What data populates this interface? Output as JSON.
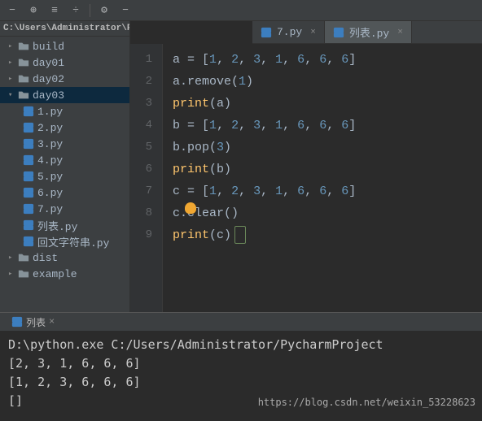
{
  "toolbar": {
    "icons": [
      "minimize",
      "target",
      "collapse",
      "divide",
      "gear",
      "hide"
    ]
  },
  "tabs": [
    {
      "label": "7.py",
      "active": false
    },
    {
      "label": "列表.py",
      "active": true
    }
  ],
  "breadcrumb": "C:\\Users\\Administrator\\P",
  "tree": [
    {
      "type": "folder",
      "label": "build",
      "lvl": 1,
      "open": false
    },
    {
      "type": "folder",
      "label": "day01",
      "lvl": 1,
      "open": false
    },
    {
      "type": "folder",
      "label": "day02",
      "lvl": 1,
      "open": false
    },
    {
      "type": "folder",
      "label": "day03",
      "lvl": 1,
      "open": true,
      "selected": true
    },
    {
      "type": "file",
      "label": "1.py",
      "lvl": 2
    },
    {
      "type": "file",
      "label": "2.py",
      "lvl": 2
    },
    {
      "type": "file",
      "label": "3.py",
      "lvl": 2
    },
    {
      "type": "file",
      "label": "4.py",
      "lvl": 2
    },
    {
      "type": "file",
      "label": "5.py",
      "lvl": 2
    },
    {
      "type": "file",
      "label": "6.py",
      "lvl": 2
    },
    {
      "type": "file",
      "label": "7.py",
      "lvl": 2
    },
    {
      "type": "file",
      "label": "列表.py",
      "lvl": 2
    },
    {
      "type": "file",
      "label": "回文字符串.py",
      "lvl": 2
    },
    {
      "type": "folder",
      "label": "dist",
      "lvl": 1,
      "open": false
    },
    {
      "type": "folder",
      "label": "example",
      "lvl": 1,
      "open": false
    }
  ],
  "code": {
    "lines": [
      {
        "n": 1,
        "tokens": [
          {
            "t": "a ",
            "c": "var"
          },
          {
            "t": "= ",
            "c": "punct"
          },
          {
            "t": "[",
            "c": "punct"
          },
          {
            "t": "1",
            "c": "num"
          },
          {
            "t": ", ",
            "c": "punct"
          },
          {
            "t": "2",
            "c": "num"
          },
          {
            "t": ", ",
            "c": "punct"
          },
          {
            "t": "3",
            "c": "num"
          },
          {
            "t": ", ",
            "c": "punct"
          },
          {
            "t": "1",
            "c": "num"
          },
          {
            "t": ", ",
            "c": "punct"
          },
          {
            "t": "6",
            "c": "num"
          },
          {
            "t": ", ",
            "c": "punct"
          },
          {
            "t": "6",
            "c": "num"
          },
          {
            "t": ", ",
            "c": "punct"
          },
          {
            "t": "6",
            "c": "num"
          },
          {
            "t": "]",
            "c": "punct"
          }
        ]
      },
      {
        "n": 2,
        "tokens": [
          {
            "t": "a.remove(",
            "c": "var"
          },
          {
            "t": "1",
            "c": "num"
          },
          {
            "t": ")",
            "c": "var"
          }
        ]
      },
      {
        "n": 3,
        "tokens": [
          {
            "t": "print",
            "c": "call"
          },
          {
            "t": "(a)",
            "c": "var"
          }
        ]
      },
      {
        "n": 4,
        "tokens": [
          {
            "t": "b ",
            "c": "var"
          },
          {
            "t": "= ",
            "c": "punct"
          },
          {
            "t": "[",
            "c": "punct"
          },
          {
            "t": "1",
            "c": "num"
          },
          {
            "t": ", ",
            "c": "punct"
          },
          {
            "t": "2",
            "c": "num"
          },
          {
            "t": ", ",
            "c": "punct"
          },
          {
            "t": "3",
            "c": "num"
          },
          {
            "t": ", ",
            "c": "punct"
          },
          {
            "t": "1",
            "c": "num"
          },
          {
            "t": ", ",
            "c": "punct"
          },
          {
            "t": "6",
            "c": "num"
          },
          {
            "t": ", ",
            "c": "punct"
          },
          {
            "t": "6",
            "c": "num"
          },
          {
            "t": ", ",
            "c": "punct"
          },
          {
            "t": "6",
            "c": "num"
          },
          {
            "t": "]",
            "c": "punct"
          }
        ]
      },
      {
        "n": 5,
        "tokens": [
          {
            "t": "b.pop(",
            "c": "var"
          },
          {
            "t": "3",
            "c": "num"
          },
          {
            "t": ")",
            "c": "var"
          }
        ]
      },
      {
        "n": 6,
        "tokens": [
          {
            "t": "print",
            "c": "call"
          },
          {
            "t": "(b)",
            "c": "var"
          }
        ]
      },
      {
        "n": 7,
        "tokens": [
          {
            "t": "c ",
            "c": "var"
          },
          {
            "t": "= ",
            "c": "punct"
          },
          {
            "t": "[",
            "c": "punct"
          },
          {
            "t": "1",
            "c": "num"
          },
          {
            "t": ", ",
            "c": "punct"
          },
          {
            "t": "2",
            "c": "num"
          },
          {
            "t": ", ",
            "c": "punct"
          },
          {
            "t": "3",
            "c": "num"
          },
          {
            "t": ", ",
            "c": "punct"
          },
          {
            "t": "1",
            "c": "num"
          },
          {
            "t": ", ",
            "c": "punct"
          },
          {
            "t": "6",
            "c": "num"
          },
          {
            "t": ", ",
            "c": "punct"
          },
          {
            "t": "6",
            "c": "num"
          },
          {
            "t": ", ",
            "c": "punct"
          },
          {
            "t": "6",
            "c": "num"
          },
          {
            "t": "]",
            "c": "punct"
          }
        ]
      },
      {
        "n": 8,
        "tokens": [
          {
            "t": "c.clear()",
            "c": "var"
          }
        ]
      },
      {
        "n": 9,
        "tokens": [
          {
            "t": "print",
            "c": "call"
          },
          {
            "t": "(",
            "c": "var"
          },
          {
            "t": "c",
            "c": "var"
          },
          {
            "t": ")",
            "c": "var"
          }
        ],
        "caret": true
      }
    ]
  },
  "terminal": {
    "tab_label": "列表",
    "lines": [
      "D:\\python.exe C:/Users/Administrator/PycharmProject",
      "[2, 3, 1, 6, 6, 6]",
      "[1, 2, 3, 6, 6, 6]",
      "[]"
    ]
  },
  "watermark": "https://blog.csdn.net/weixin_53228623"
}
